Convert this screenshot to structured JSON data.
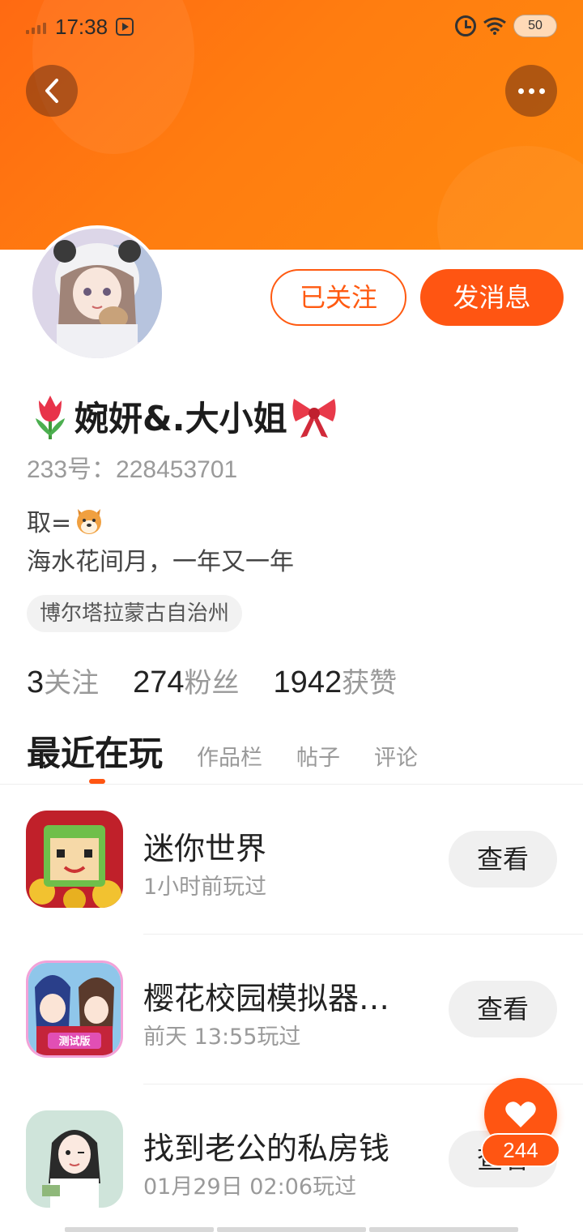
{
  "status_bar": {
    "time": "17:38",
    "battery": "50"
  },
  "profile": {
    "name": "婉妍&.大小姐",
    "uid": "233号：228453701",
    "bio_line1": "取=",
    "bio_line2": "海水花间月，一年又一年",
    "location": "博尔塔拉蒙古自治州"
  },
  "actions": {
    "followed": "已关注",
    "message": "发消息"
  },
  "stats": [
    {
      "num": "3",
      "label": "关注"
    },
    {
      "num": "274",
      "label": "粉丝"
    },
    {
      "num": "1942",
      "label": "获赞"
    }
  ],
  "tabs": {
    "active": "最近在玩",
    "items": [
      "作品栏",
      "帖子",
      "评论"
    ]
  },
  "games": [
    {
      "title": "迷你世界",
      "sub": "1小时前玩过",
      "button": "查看"
    },
    {
      "title": "樱花校园模拟器…",
      "sub": "前天 13:55玩过",
      "button": "查看"
    },
    {
      "title": "找到老公的私房钱",
      "sub": "01月29日 02:06玩过",
      "button": "查看"
    }
  ],
  "like": {
    "count": "244"
  },
  "colors": {
    "accent": "#ff5512",
    "header": "#ff7a10"
  }
}
